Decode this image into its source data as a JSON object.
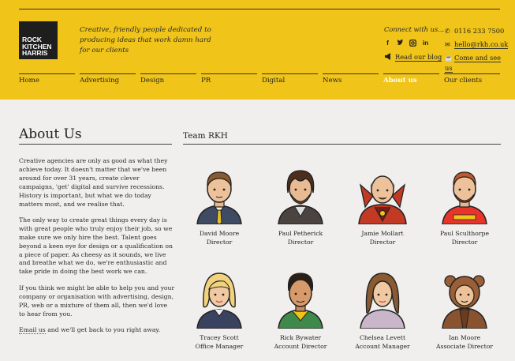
{
  "header": {
    "logo": [
      "ROCK",
      "KITCHEN",
      "HARRIS"
    ],
    "tagline": "Creative, friendly people dedicated to producing ideas that work damn hard for our clients",
    "connect": "Connect with us...",
    "social_icons": [
      "f",
      "twitter-bird",
      "instagram",
      "in"
    ],
    "blog_label": "Read our blog",
    "phone": "0116 233 7500",
    "email": "hello@rkh.co.uk",
    "come_label": "Come and see us"
  },
  "nav": [
    "Home",
    "Advertising",
    "Design",
    "PR",
    "Digital",
    "News",
    "About us",
    "Our clients"
  ],
  "about": {
    "title": "About Us",
    "p1": "Creative agencies are only as good as what they achieve today. It doesn't matter that we've been around for over 31 years, create clever campaigns, 'get' digital and survive recessions. History is important, but what we do today matters most, and we realise that.",
    "p2": "The only way to create great things every day is with great people who truly enjoy their job, so we make sure we only hire the best. Talent goes beyond a keen eye for design or a qualification on a piece of paper. As cheesy as it sounds, we live and breathe what we do, we're enthusiastic and take pride in doing the best work we can.",
    "p3": "If you think we might be able to help you and your company or organisation with advertising, design, PR, web or a mixture of them all, then we'd love to hear from you.",
    "p4_link": "Email us",
    "p4_rest": " and we'll get back to you right away."
  },
  "team": {
    "title": "Team RKH",
    "members": [
      {
        "name": "David Moore",
        "role": "Director"
      },
      {
        "name": "Paul Petherick",
        "role": "Director"
      },
      {
        "name": "Jamie Mollart",
        "role": "Director"
      },
      {
        "name": "Paul Sculthorpe",
        "role": "Director"
      },
      {
        "name": "Tracey Scott",
        "role": "Office Manager"
      },
      {
        "name": "Rick Bywater",
        "role": "Account Director"
      },
      {
        "name": "Chelsea Levett",
        "role": "Account Manager"
      },
      {
        "name": "Ian Moore",
        "role": "Associate Director"
      }
    ]
  },
  "colors": {
    "brand_yellow": "#f0c419",
    "page_bg": "#f1efed",
    "ink": "#222222"
  }
}
